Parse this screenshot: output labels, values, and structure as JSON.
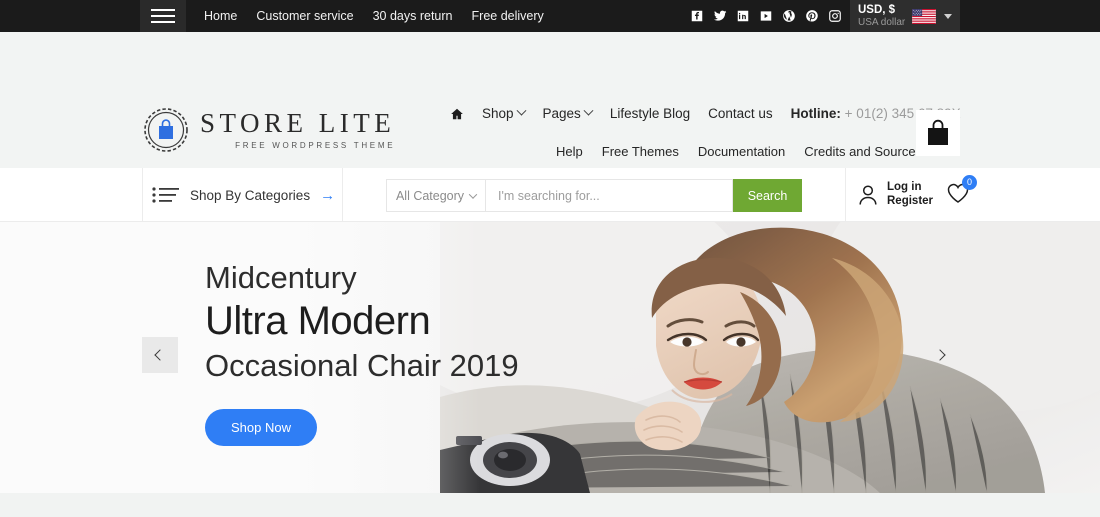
{
  "topbar": {
    "menu_icon": "hamburger-icon",
    "links": [
      "Home",
      "Customer service",
      "30 days return",
      "Free delivery"
    ],
    "socials": [
      "facebook-icon",
      "twitter-icon",
      "linkedin-icon",
      "youtube-icon",
      "wordpress-icon",
      "pinterest-icon",
      "instagram-icon"
    ],
    "currency": {
      "code": "USD, $",
      "name": "USA dollar",
      "flag": "usa-flag-icon"
    }
  },
  "header": {
    "logo": {
      "title": "STORE LITE",
      "subtitle": "FREE WORDPRESS THEME",
      "icon": "shopping-bag-logo-icon"
    },
    "nav": {
      "home_icon": "home-icon",
      "shop": "Shop",
      "pages": "Pages",
      "blog": "Lifestyle Blog",
      "contact": "Contact us",
      "hotline_label": "Hotline:",
      "hotline_number": "+ 01(2) 345 67 89X"
    },
    "subnav": [
      "Help",
      "Free Themes",
      "Documentation",
      "Credits and Sources"
    ],
    "cart_icon": "shopping-bag-icon"
  },
  "searchrow": {
    "categories_label": "Shop By Categories",
    "categories_icon": "list-icon",
    "categories_arrow": "→",
    "category_select": "All Category",
    "search_placeholder": "I'm searching for...",
    "search_value": "",
    "search_button": "Search",
    "account_icon": "user-icon",
    "account_line1": "Log in",
    "account_line2": "Register",
    "wishlist_icon": "heart-icon",
    "wishlist_count": "0"
  },
  "hero": {
    "line1": "Midcentury",
    "line2": "Ultra Modern",
    "line3": "Occasional Chair 2019",
    "cta": "Shop Now",
    "prev_icon": "chevron-left-icon",
    "next_icon": "chevron-right-icon"
  },
  "colors": {
    "accent_blue": "#2f7ef5",
    "search_green": "#6fa833",
    "topbar_dark": "#1b1b1b",
    "header_bg": "#f2f4f3"
  }
}
